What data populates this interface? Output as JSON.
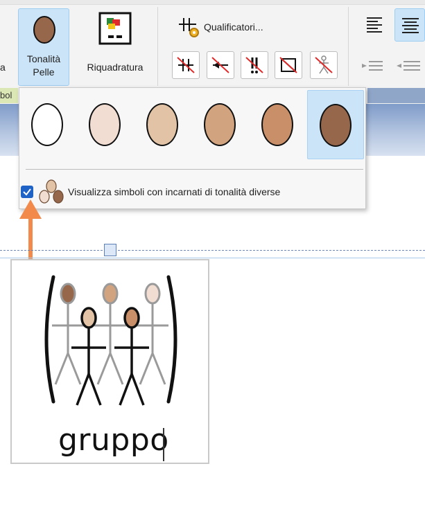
{
  "ribbon": {
    "partial_label_left": "a",
    "tonalita_label_line1": "Tonalità",
    "tonalita_label_line2": "Pelle",
    "riquadratura_label": "Riquadratura",
    "qualificatori_label": "Qualificatori...",
    "group_label_partial": "bol",
    "qualifier_buttons": [
      "plural-qualifier-icon",
      "past-qualifier-icon",
      "exclamation-qualifier-icon",
      "negation-box-qualifier-icon",
      "person-qualifier-icon"
    ]
  },
  "skin_tone_popup": {
    "swatches": [
      {
        "name": "white",
        "color": "#ffffff"
      },
      {
        "name": "very-light",
        "color": "#f2ddd3"
      },
      {
        "name": "light",
        "color": "#e2c3a5"
      },
      {
        "name": "medium",
        "color": "#d2a37f"
      },
      {
        "name": "tan",
        "color": "#c88f68"
      },
      {
        "name": "dark",
        "color": "#96674a"
      }
    ],
    "selected_index": 5,
    "checkbox_checked": true,
    "checkbox_label": "Visualizza simboli con incarnati di tonalità diverse"
  },
  "document": {
    "symbol_word": "gruppo"
  },
  "colors": {
    "accent": "#cce4f7",
    "arrow": "#f28a4c",
    "checkbox": "#1f63c6"
  }
}
